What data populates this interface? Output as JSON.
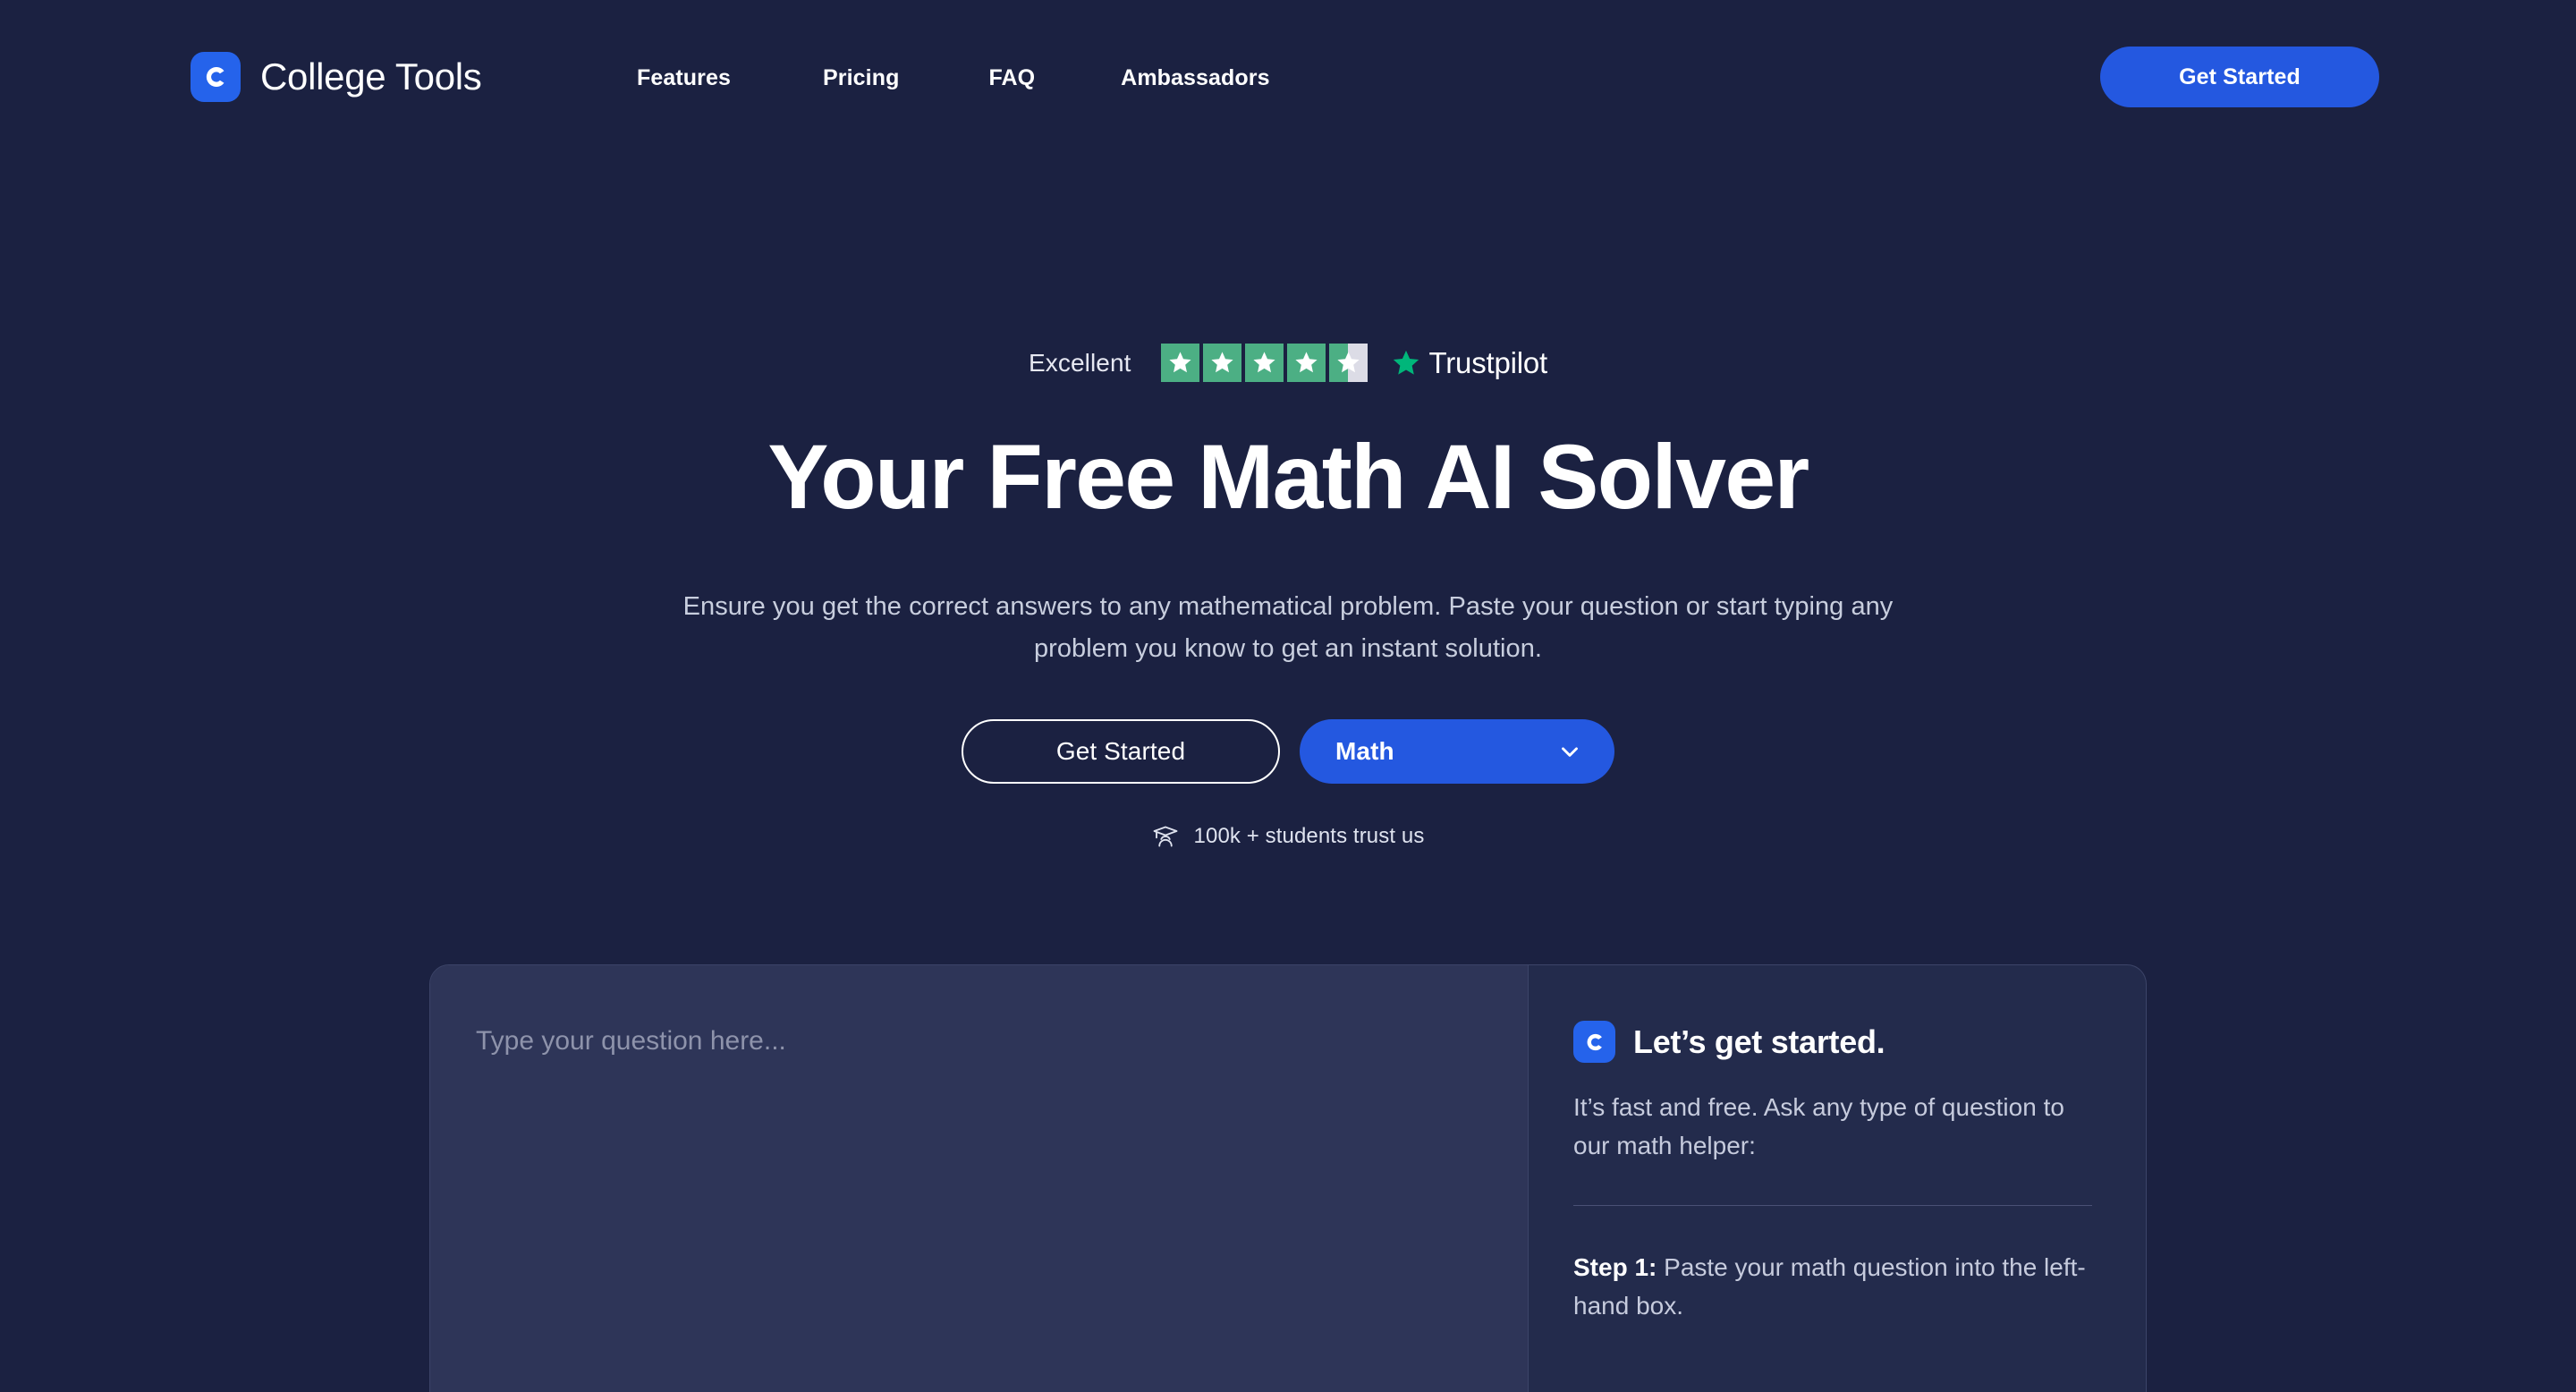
{
  "brand": {
    "name": "College Tools",
    "logo_icon": "college-tools-c-logo",
    "logo_color": "#2563eb"
  },
  "header": {
    "nav": [
      {
        "label": "Features"
      },
      {
        "label": "Pricing"
      },
      {
        "label": "FAQ"
      },
      {
        "label": "Ambassadors"
      }
    ],
    "cta_label": "Get Started",
    "cta_color": "#2458e0"
  },
  "hero": {
    "rating": {
      "word": "Excellent",
      "stars_filled": 4,
      "stars_half": 1,
      "stars_total": 5,
      "provider": "Trustpilot",
      "star_color": "#4caf84",
      "provider_star_color": "#00b67a",
      "empty_color": "#dcdce6"
    },
    "title": "Your Free Math AI Solver",
    "subtitle": "Ensure you get the correct answers to any mathematical problem. Paste your question or start typing any problem you know to get an instant solution.",
    "primary_cta": "Get Started",
    "subject_select": {
      "value": "Math",
      "icon": "chevron-down-icon"
    },
    "social_proof": {
      "icon": "graduation-cap-icon",
      "text": "100k + students trust us"
    }
  },
  "solver": {
    "input_placeholder": "Type your question here...",
    "input_value": "",
    "panel": {
      "title": "Let’s get started.",
      "logo_icon": "college-tools-c-logo",
      "body": "It’s fast and free. Ask any type of question to our math helper:",
      "step_label": "Step 1:",
      "step_text": " Paste your math question into the left-hand box."
    }
  },
  "colors": {
    "background": "#1b2141",
    "panel_left": "#2e3558",
    "panel_right": "#232b4c",
    "accent": "#2458e0",
    "border": "#3c4468"
  }
}
